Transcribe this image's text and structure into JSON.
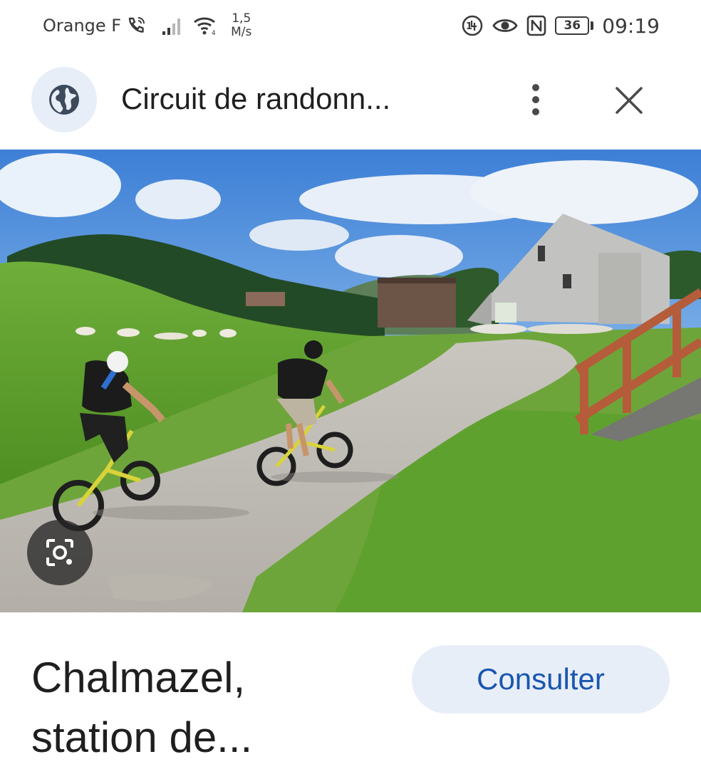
{
  "status_bar": {
    "carrier": "Orange F",
    "speed_value": "1,5",
    "speed_unit": "M/s",
    "battery": "36",
    "time": "09:19",
    "icons": [
      "wifi-calling-icon",
      "signal-icon",
      "wifi-icon",
      "hd-voice-icon",
      "eye-comfort-icon",
      "nfc-icon",
      "battery-icon"
    ]
  },
  "header": {
    "title": "Circuit de randonn...",
    "icons": [
      "globe-icon",
      "more-vert-icon",
      "close-icon"
    ]
  },
  "image": {
    "subject": "photo",
    "lens_icon": "google-lens-icon"
  },
  "result": {
    "caption_line1": "Chalmazel,",
    "caption_line2": "station de...",
    "action_label": "Consulter"
  },
  "colors": {
    "accent": "#1a56b0",
    "button_bg": "#e8eef8"
  }
}
